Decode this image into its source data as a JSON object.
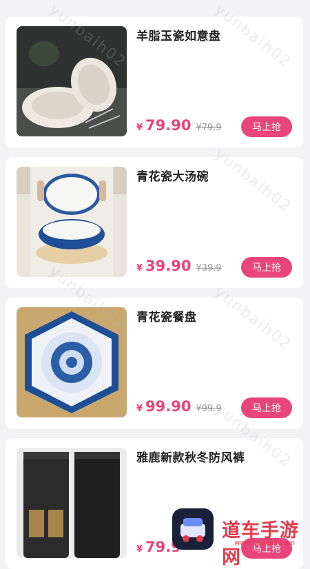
{
  "products": [
    {
      "title": "羊脂玉瓷如意盘",
      "currency": "¥",
      "price": "79.90",
      "old_price": "¥79.9",
      "buy_label": "马上抢"
    },
    {
      "title": "青花瓷大汤碗",
      "currency": "¥",
      "price": "39.90",
      "old_price": "¥39.9",
      "buy_label": "马上抢"
    },
    {
      "title": "青花瓷餐盘",
      "currency": "¥",
      "price": "99.90",
      "old_price": "¥99.9",
      "buy_label": "马上抢"
    },
    {
      "title": "雅鹿新款秋冬防风裤",
      "currency": "¥",
      "price": "79.9",
      "old_price": "",
      "buy_label": "马上抢"
    }
  ],
  "watermark": "yunbaih02",
  "site_badge": {
    "name": "道车手游网",
    "url": "www.daoch2.com"
  },
  "colors": {
    "accent": "#e8457c",
    "price": "#e8447a"
  }
}
